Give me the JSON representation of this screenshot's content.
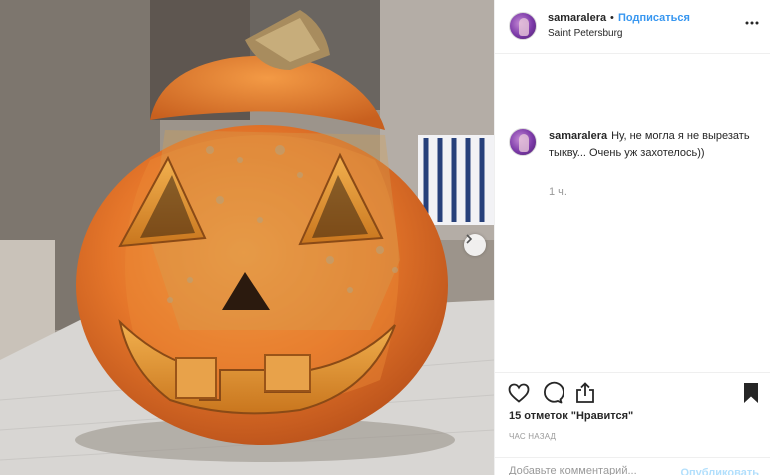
{
  "post": {
    "username": "samaralera",
    "dot": "•",
    "follow_label": "Подписаться",
    "location": "Saint Petersburg",
    "more_icon": "more-horizontal-icon"
  },
  "caption": {
    "username": "samaralera",
    "text": "Ну, не могла я не вырезать тыкву... Очень уж захотелось))",
    "time": "1 ч."
  },
  "actions": {
    "like_icon": "heart-icon",
    "comment_icon": "comment-bubble-icon",
    "share_icon": "share-icon",
    "save_icon": "bookmark-icon",
    "likes": "15 отметок \"Нравится\"",
    "time_ago": "ЧАС НАЗАД"
  },
  "comment_box": {
    "placeholder": "Добавьте комментарий...",
    "publish_label": "Опубликовать"
  },
  "photo": {
    "subject": "carved jack-o'-lantern pumpkin",
    "next_icon": "chevron-right-icon"
  },
  "colors": {
    "accent": "#3897f0",
    "publish_disabled": "#b2dffc",
    "pumpkin": "#e8742a"
  }
}
